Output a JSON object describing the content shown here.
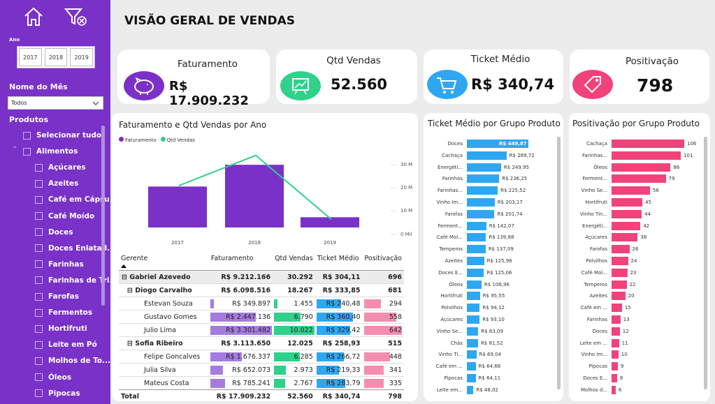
{
  "page_title": "VISÃO GERAL DE VENDAS",
  "sidebar": {
    "year_label": "Ano",
    "years": [
      "2017",
      "2018",
      "2019"
    ],
    "month_label": "Nome do Mês",
    "month_value": "Todos",
    "products_label": "Produtos",
    "products": [
      {
        "label": "Selecionar tudo",
        "indent": 0
      },
      {
        "label": "Alimentos",
        "indent": 0
      },
      {
        "label": "Açúcares",
        "indent": 1
      },
      {
        "label": "Azeites",
        "indent": 1
      },
      {
        "label": "Café em Cápsu...",
        "indent": 1
      },
      {
        "label": "Café Moído",
        "indent": 1
      },
      {
        "label": "Doces",
        "indent": 1
      },
      {
        "label": "Doces Enlatad...",
        "indent": 1
      },
      {
        "label": "Farinhas",
        "indent": 1
      },
      {
        "label": "Farinhas de Tri...",
        "indent": 1
      },
      {
        "label": "Farofas",
        "indent": 1
      },
      {
        "label": "Fermentos",
        "indent": 1
      },
      {
        "label": "Hortifruti",
        "indent": 1
      },
      {
        "label": "Leite em Pó",
        "indent": 1
      },
      {
        "label": "Molhos de To...",
        "indent": 1
      },
      {
        "label": "Óleos",
        "indent": 1
      },
      {
        "label": "Pipocas",
        "indent": 1
      }
    ]
  },
  "kpis": {
    "faturamento": {
      "label": "Faturamento",
      "value": "R$ 17.909.232"
    },
    "qtd": {
      "label": "Qtd Vendas",
      "value": "52.560"
    },
    "ticket": {
      "label": "Ticket Médio",
      "value": "R$ 340,74"
    },
    "posit": {
      "label": "Positivação",
      "value": "798"
    }
  },
  "combo": {
    "title": "Faturamento e Qtd Vendas por Ano",
    "legend": [
      "Faturamento",
      "Qtd Vendas"
    ],
    "right_ticks": [
      "30 Mil",
      "20 Mil",
      "10 Mil",
      "0 Mil"
    ]
  },
  "chart_data": [
    {
      "type": "bar",
      "title": "Faturamento e Qtd Vendas por Ano",
      "categories": [
        "2017",
        "2018",
        "2019"
      ],
      "series": [
        {
          "name": "Faturamento",
          "values": [
            6.4,
            9.8,
            1.6
          ]
        },
        {
          "name": "Qtd Vendas",
          "values": [
            18000,
            31000,
            3500
          ]
        }
      ],
      "right_ticks": [
        "30 Mil",
        "20 Mil",
        "10 Mil",
        "0 Mil"
      ]
    },
    {
      "type": "bar",
      "title": "Ticket Médio por Grupo Produto",
      "categories": [
        "Doces",
        "Cachaça",
        "Energéti...",
        "Farinhas",
        "Farinhas...",
        "Vinho Im...",
        "Farofas",
        "Ferment...",
        "Café Moí...",
        "Temperos",
        "Azeites",
        "Doces E...",
        "Óleos",
        "Hortifruti",
        "Polvilhos",
        "Açúcares",
        "Vinho Se...",
        "Chás",
        "Vinho Ti...",
        "Café em ...",
        "Pipocas",
        "Leite em..."
      ],
      "values": [
        449.87,
        289.72,
        249.95,
        236.25,
        225.52,
        203.17,
        201.74,
        142.07,
        139.88,
        137.09,
        125.96,
        125.06,
        106.96,
        95.55,
        94.12,
        93.1,
        83.09,
        81.52,
        69.04,
        64.68,
        64.11,
        48.02
      ],
      "labels": [
        "R$ 449,87",
        "R$ 289,72",
        "R$ 249,95",
        "R$ 236,25",
        "R$ 225,52",
        "R$ 203,17",
        "R$ 201,74",
        "R$ 142,07",
        "R$ 139,88",
        "R$ 137,09",
        "R$ 125,96",
        "R$ 125,06",
        "R$ 106,96",
        "R$ 95,55",
        "R$ 94,12",
        "R$ 93,10",
        "R$ 83,09",
        "R$ 81,52",
        "R$ 69,04",
        "R$ 64,68",
        "R$ 64,11",
        "R$ 48,02"
      ]
    },
    {
      "type": "bar",
      "title": "Positivação por Grupo Produto",
      "categories": [
        "Cachaça",
        "Farinhas...",
        "Óleos",
        "Ferment...",
        "Vinho Se...",
        "Hortifruti",
        "Vinho Tin...",
        "Energéti...",
        "Açúcares",
        "Farofas",
        "Polvilhos",
        "Café Moí...",
        "Temperos",
        "Azeites",
        "Café em ...",
        "Farinhas",
        "Doces",
        "Leite em ...",
        "Vinho Im...",
        "Pipocas",
        "Doces E...",
        "Molhos d..."
      ],
      "values": [
        106,
        101,
        86,
        79,
        56,
        45,
        44,
        42,
        38,
        26,
        24,
        23,
        22,
        20,
        15,
        13,
        12,
        11,
        10,
        9,
        8,
        6
      ]
    }
  ],
  "table": {
    "headers": [
      "Gerente",
      "Faturamento",
      "Qtd Vendas",
      "Ticket Médio",
      "Positivação"
    ],
    "rows": [
      {
        "name": "Gabriel Azevedo",
        "level": 0,
        "fat": "R$ 9.212.166",
        "qtd": "30.292",
        "tk": "R$ 304,11",
        "pos": "696",
        "bold": true,
        "bars": false
      },
      {
        "name": "Diogo Carvalho",
        "level": 1,
        "fat": "R$ 6.098.516",
        "qtd": "18.267",
        "tk": "R$ 333,85",
        "pos": "681",
        "bold": true,
        "bars": false
      },
      {
        "name": "Estevan Souza",
        "level": 2,
        "fat": "R$ 349.897",
        "qtd": "1.455",
        "tk": "R$ 240,48",
        "pos": "294",
        "bold": false,
        "bars": true,
        "f": 0.06,
        "q": 0.08,
        "t": 0.55,
        "p": 0.46
      },
      {
        "name": "Gustavo Gomes",
        "level": 2,
        "fat": "R$ 2.447.136",
        "qtd": "6.790",
        "tk": "R$ 360,40",
        "pos": "558",
        "bold": false,
        "bars": true,
        "f": 0.74,
        "q": 0.66,
        "t": 0.82,
        "p": 0.87
      },
      {
        "name": "Julio Lima",
        "level": 2,
        "fat": "R$ 3.301.482",
        "qtd": "10.022",
        "tk": "R$ 329,42",
        "pos": "642",
        "bold": false,
        "bars": true,
        "f": 1.0,
        "q": 1.0,
        "t": 0.75,
        "p": 1.0
      },
      {
        "name": "Sofia Ribeiro",
        "level": 1,
        "fat": "R$ 3.113.650",
        "qtd": "12.025",
        "tk": "R$ 258,93",
        "pos": "515",
        "bold": true,
        "bars": false
      },
      {
        "name": "Felipe Goncalves",
        "level": 2,
        "fat": "R$ 1.676.337",
        "qtd": "6.285",
        "tk": "R$ 266,72",
        "pos": "448",
        "bold": false,
        "bars": true,
        "f": 0.51,
        "q": 0.63,
        "t": 0.61,
        "p": 0.7
      },
      {
        "name": "Julia Silva",
        "level": 2,
        "fat": "R$ 652.073",
        "qtd": "2.973",
        "tk": "R$ 219,33",
        "pos": "341",
        "bold": false,
        "bars": true,
        "f": 0.2,
        "q": 0.3,
        "t": 0.5,
        "p": 0.53
      },
      {
        "name": "Mateus Costa",
        "level": 2,
        "fat": "R$ 785.241",
        "qtd": "2.767",
        "tk": "R$ 283,79",
        "pos": "335",
        "bold": false,
        "bars": true,
        "f": 0.24,
        "q": 0.28,
        "t": 0.65,
        "p": 0.52
      }
    ],
    "total": {
      "name": "Total",
      "fat": "R$ 17.909.232",
      "qtd": "52.560",
      "tk": "R$ 340,74",
      "pos": "798"
    }
  },
  "colors": {
    "purple": "#7a31c7",
    "green": "#2fd18b",
    "blue": "#2ea7f2",
    "pink": "#f2427a"
  },
  "icons": [
    "home-icon",
    "filter-clear-icon",
    "piggy-bank-icon",
    "presentation-chart-icon",
    "shopping-cart-icon",
    "price-tag-icon",
    "chevron-down-icon",
    "sort-up-icon"
  ]
}
